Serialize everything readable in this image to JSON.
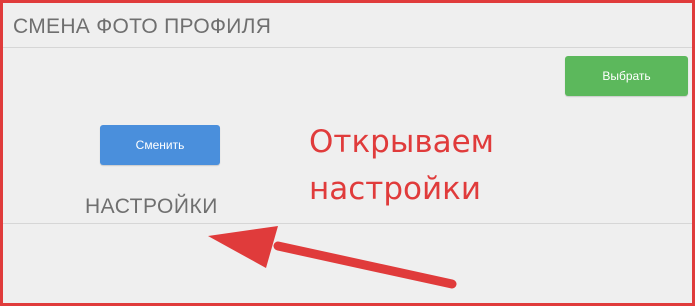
{
  "header": {
    "title": "СМЕНА ФОТО ПРОФИЛЯ"
  },
  "buttons": {
    "choose_label": "Выбрать",
    "change_label": "Сменить"
  },
  "section": {
    "settings_title": "НАСТРОЙКИ"
  },
  "annotation": {
    "line1": "Открываем",
    "line2": "настройки",
    "color": "#e03b3b"
  },
  "colors": {
    "choose_button": "#5cb85c",
    "change_button": "#4a8fdc",
    "frame_border": "#e03b3b"
  }
}
